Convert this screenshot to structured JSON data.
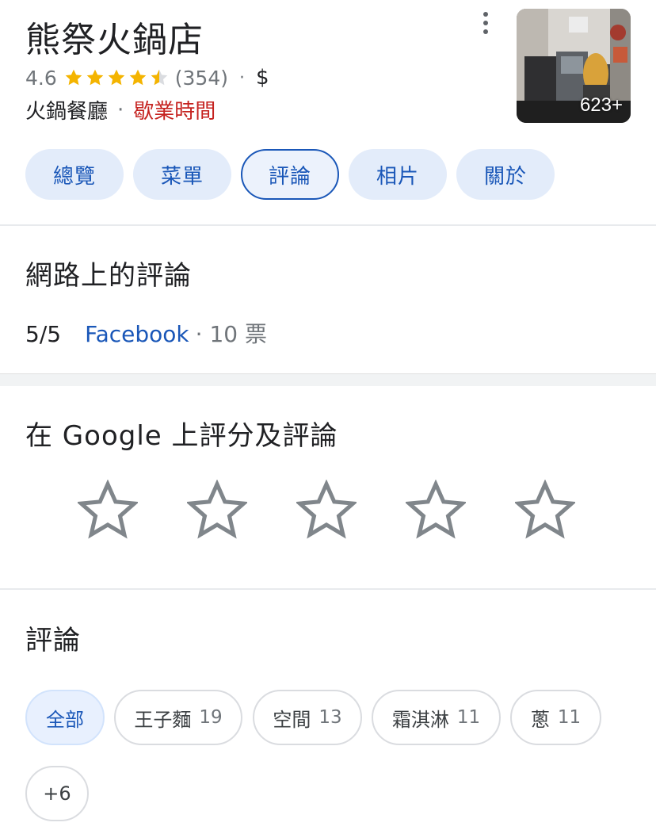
{
  "place": {
    "name": "熊祭火鍋店",
    "rating": "4.6",
    "rating_value": 4.6,
    "review_count": "(354)",
    "price": "$",
    "category": "火鍋餐廳",
    "hours_label": "歇業時間",
    "photo_count": "623+"
  },
  "tabs": [
    {
      "label": "總覽"
    },
    {
      "label": "菜單"
    },
    {
      "label": "評論",
      "active": true
    },
    {
      "label": "相片"
    },
    {
      "label": "關於"
    }
  ],
  "web_reviews": {
    "heading": "網路上的評論",
    "score": "5/5",
    "source": "Facebook",
    "votes": "· 10 票"
  },
  "rate_section": {
    "heading": "在 Google 上評分及評論",
    "star_count": 5
  },
  "reviews": {
    "heading": "評論",
    "chips": [
      {
        "label": "全部",
        "count": "",
        "active": true
      },
      {
        "label": "王子麵",
        "count": "19"
      },
      {
        "label": "空間",
        "count": "13"
      },
      {
        "label": "霜淇淋",
        "count": "11"
      },
      {
        "label": "蔥",
        "count": "11"
      },
      {
        "label": "+6",
        "count": ""
      }
    ]
  },
  "colors": {
    "accent_blue": "#1a57b8",
    "star_gold": "#f4b400",
    "closed_red": "#c5221f",
    "chip_bg": "#e3ecfa"
  }
}
